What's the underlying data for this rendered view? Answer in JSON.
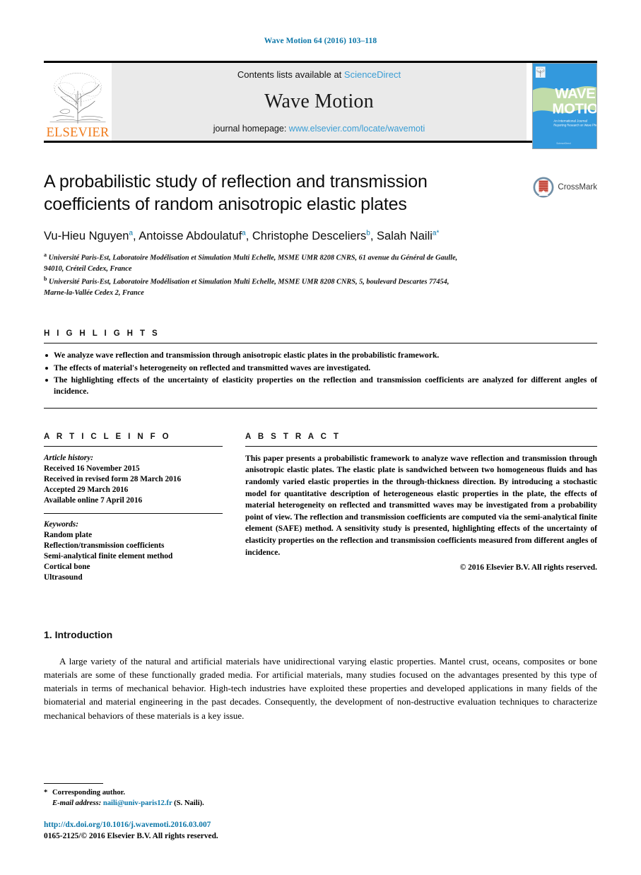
{
  "running_head": "Wave Motion 64 (2016) 103–118",
  "masthead": {
    "contents_prefix": "Contents lists available at ",
    "sciencedirect": "ScienceDirect",
    "journal_name": "Wave Motion",
    "homepage_prefix": "journal homepage: ",
    "homepage_url": "www.elsevier.com/locate/wavemoti",
    "publisher_logo_text": "ELSEVIER",
    "cover_title_line1": "WAVE",
    "cover_title_line2": "MOTION",
    "cover_subtitle_line1": "An International Journal",
    "cover_subtitle_line2": "Reporting Research on Wave Phenomena"
  },
  "article": {
    "title": "A probabilistic study of reflection and transmission coefficients of random anisotropic elastic plates",
    "crossmark_label": "CrossMark",
    "authors": [
      {
        "name": "Vu-Hieu Nguyen",
        "mark": "a",
        "sep": ", "
      },
      {
        "name": "Antoisse Abdoulatuf",
        "mark": "a",
        "sep": ", "
      },
      {
        "name": "Christophe Desceliers",
        "mark": "b",
        "sep": ", "
      },
      {
        "name": "Salah Naili",
        "mark": "a*",
        "sep": ""
      }
    ],
    "affiliations": [
      {
        "mark": "a",
        "line1": "Université Paris-Est, Laboratoire Modélisation et Simulation Multi Echelle, MSME UMR 8208 CNRS, 61 avenue du Général de Gaulle,",
        "line2": "94010, Créteil Cedex, France"
      },
      {
        "mark": "b",
        "line1": "Université Paris-Est, Laboratoire Modélisation et Simulation Multi Echelle, MSME UMR 8208 CNRS, 5, boulevard Descartes 77454,",
        "line2": "Marne-la-Vallée Cedex 2, France"
      }
    ]
  },
  "highlights": {
    "heading": "H I G H L I G H T S",
    "items": [
      "We analyze wave reflection and transmission through anisotropic elastic plates in the probabilistic framework.",
      "The effects of material's heterogeneity on reflected and transmitted waves are investigated.",
      "The highlighting effects of the uncertainty of elasticity properties on the reflection and transmission coefficients are analyzed for different angles of incidence."
    ]
  },
  "article_info": {
    "heading": "A R T I C L E   I N F O",
    "history_label": "Article history:",
    "history": [
      "Received 16 November 2015",
      "Received in revised form 28 March 2016",
      "Accepted 29 March 2016",
      "Available online 7 April 2016"
    ],
    "keywords_label": "Keywords:",
    "keywords": [
      "Random plate",
      "Reflection/transmission coefficients",
      "Semi-analytical finite element method",
      "Cortical bone",
      "Ultrasound"
    ]
  },
  "abstract": {
    "heading": "A B S T R A C T",
    "text": "This paper presents a probabilistic framework to analyze wave reflection and transmission through anisotropic elastic plates. The elastic plate is sandwiched between two homogeneous fluids and has randomly varied elastic properties in the through-thickness direction. By introducing a stochastic model for quantitative description of heterogeneous elastic properties in the plate, the effects of material heterogeneity on reflected and transmitted waves may be investigated from a probability point of view. The reflection and transmission coefficients are computed via the semi-analytical finite element (SAFE) method. A sensitivity study is presented, highlighting effects of the uncertainty of elasticity properties on the reflection and transmission coefficients measured from different angles of incidence.",
    "copyright": "© 2016 Elsevier B.V. All rights reserved."
  },
  "introduction": {
    "heading": "1. Introduction",
    "paragraph": "A large variety of the natural and artificial materials have unidirectional varying elastic properties. Mantel crust, oceans, composites or bone materials are some of these functionally graded media. For artificial materials, many studies focused on the advantages presented by this type of materials in terms of mechanical behavior. High-tech industries have exploited these properties and developed applications in many fields of the biomaterial and material engineering in the past decades. Consequently, the development of non-destructive evaluation techniques to characterize mechanical behaviors of these materials is a key issue."
  },
  "footer": {
    "star": "*",
    "corresponding": "Corresponding author.",
    "email_label": "E-mail address:",
    "email": "naili@univ-paris12.fr",
    "email_suffix": "(S. Naili).",
    "doi": "http://dx.doi.org/10.1016/j.wavemoti.2016.03.007",
    "issn_line": "0165-2125/© 2016 Elsevier B.V. All rights reserved."
  },
  "colors": {
    "link_blue": "#0b76a8",
    "light_link_blue": "#3a9dd4",
    "elsevier_orange": "#f07c1e",
    "masthead_gray": "#eaeaea",
    "cover_blue": "#3399dd"
  }
}
